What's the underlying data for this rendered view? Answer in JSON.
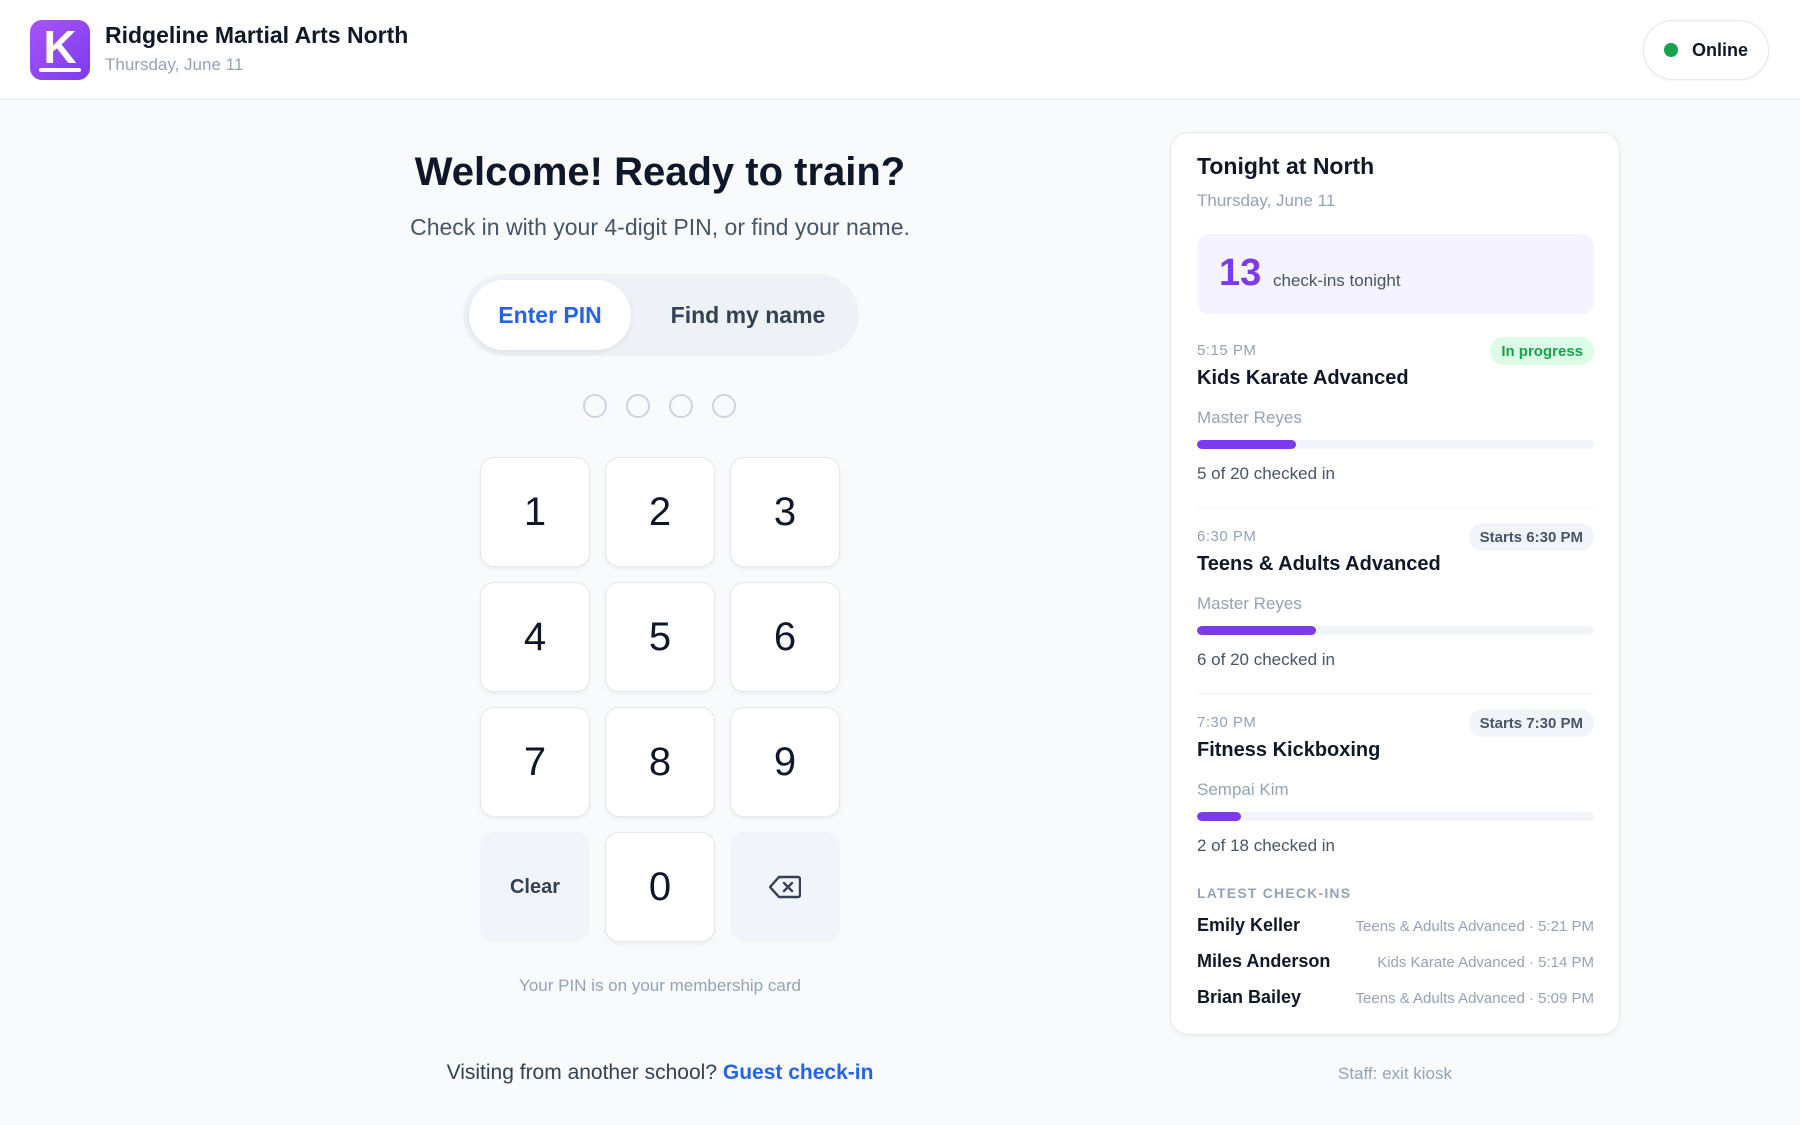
{
  "header": {
    "logo_letter": "K",
    "school_name": "Ridgeline Martial Arts North",
    "date": "Thursday, June 11",
    "status": "Online",
    "status_color": "#16a34a"
  },
  "main": {
    "title": "Welcome! Ready to train?",
    "subtitle": "Check in with your 4-digit PIN, or find your name.",
    "tabs": [
      {
        "label": "Enter PIN",
        "active": true
      },
      {
        "label": "Find my name",
        "active": false
      }
    ],
    "pin_length": 4,
    "keys": [
      "1",
      "2",
      "3",
      "4",
      "5",
      "6",
      "7",
      "8",
      "9",
      "Clear",
      "0",
      "backspace-icon"
    ],
    "clear_label": "Clear",
    "pin_hint": "Your PIN is on your membership card",
    "guest_prompt": "Visiting from another school?",
    "guest_link": "Guest check-in"
  },
  "panel": {
    "title": "Tonight at North",
    "date": "Thursday, June 11",
    "checkins_count": "13",
    "checkins_label": "check-ins tonight",
    "classes": [
      {
        "time": "5:15 PM",
        "name": "Kids Karate Advanced",
        "instructor": "Master Reyes",
        "badge": "In progress",
        "badge_status": "in-progress",
        "checked_in": 5,
        "capacity": 20,
        "count_text": "5 of 20 checked in"
      },
      {
        "time": "6:30 PM",
        "name": "Teens & Adults Advanced",
        "instructor": "Master Reyes",
        "badge": "Starts 6:30 PM",
        "badge_status": "upcoming",
        "checked_in": 6,
        "capacity": 20,
        "count_text": "6 of 20 checked in"
      },
      {
        "time": "7:30 PM",
        "name": "Fitness Kickboxing",
        "instructor": "Sempai Kim",
        "badge": "Starts 7:30 PM",
        "badge_status": "upcoming",
        "checked_in": 2,
        "capacity": 18,
        "count_text": "2 of 18 checked in"
      }
    ],
    "latest_heading": "LATEST CHECK-INS",
    "latest": [
      {
        "name": "Emily Keller",
        "detail": "Teens & Adults Advanced · 5:21 PM"
      },
      {
        "name": "Miles Anderson",
        "detail": "Kids Karate Advanced · 5:14 PM"
      },
      {
        "name": "Brian Bailey",
        "detail": "Teens & Adults Advanced · 5:09 PM"
      }
    ],
    "accent_color": "#7c3aed"
  },
  "footer": {
    "staff_exit": "Staff: exit kiosk"
  }
}
